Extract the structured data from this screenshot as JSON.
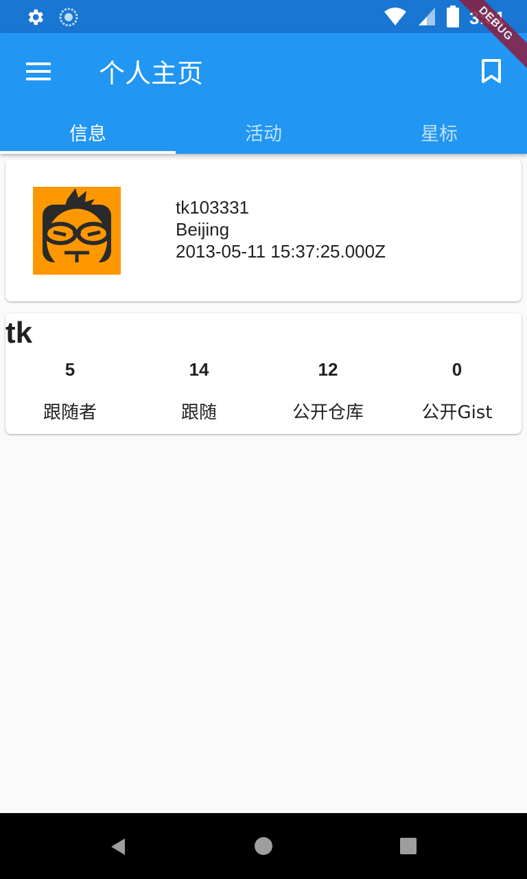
{
  "status_bar": {
    "time": "3:31",
    "icons": [
      "gear-icon",
      "sync-icon",
      "wifi-icon",
      "signal-icon",
      "battery-icon"
    ]
  },
  "debug_banner": "DEBUG",
  "app_bar": {
    "title": "个人主页",
    "menu_icon": "menu-icon",
    "bookmark_icon": "bookmark-icon",
    "color": "#2196f3"
  },
  "tabs": [
    {
      "label": "信息",
      "active": true
    },
    {
      "label": "活动",
      "active": false
    },
    {
      "label": "星标",
      "active": false
    }
  ],
  "profile": {
    "username": "tk103331",
    "location": "Beijing",
    "created_at": "2013-05-11 15:37:25.000Z",
    "avatar_color": "#ff9800"
  },
  "stats": {
    "name": "tk",
    "items": [
      {
        "count": "5",
        "label": "跟随者"
      },
      {
        "count": "14",
        "label": "跟随"
      },
      {
        "count": "12",
        "label": "公开仓库"
      },
      {
        "count": "0",
        "label": "公开Gist"
      }
    ]
  },
  "nav_bar": {
    "icons": [
      "back-icon",
      "home-icon",
      "recents-icon"
    ]
  }
}
